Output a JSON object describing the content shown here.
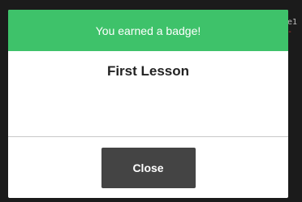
{
  "backdrop": {
    "line1": "e1",
    "line2": "-"
  },
  "dialog": {
    "header_text": "You earned a badge!",
    "badge_name": "First Lesson",
    "close_label": "Close"
  },
  "colors": {
    "header": "#3ec26a",
    "button": "#444444",
    "background": "#1b1b1b"
  }
}
